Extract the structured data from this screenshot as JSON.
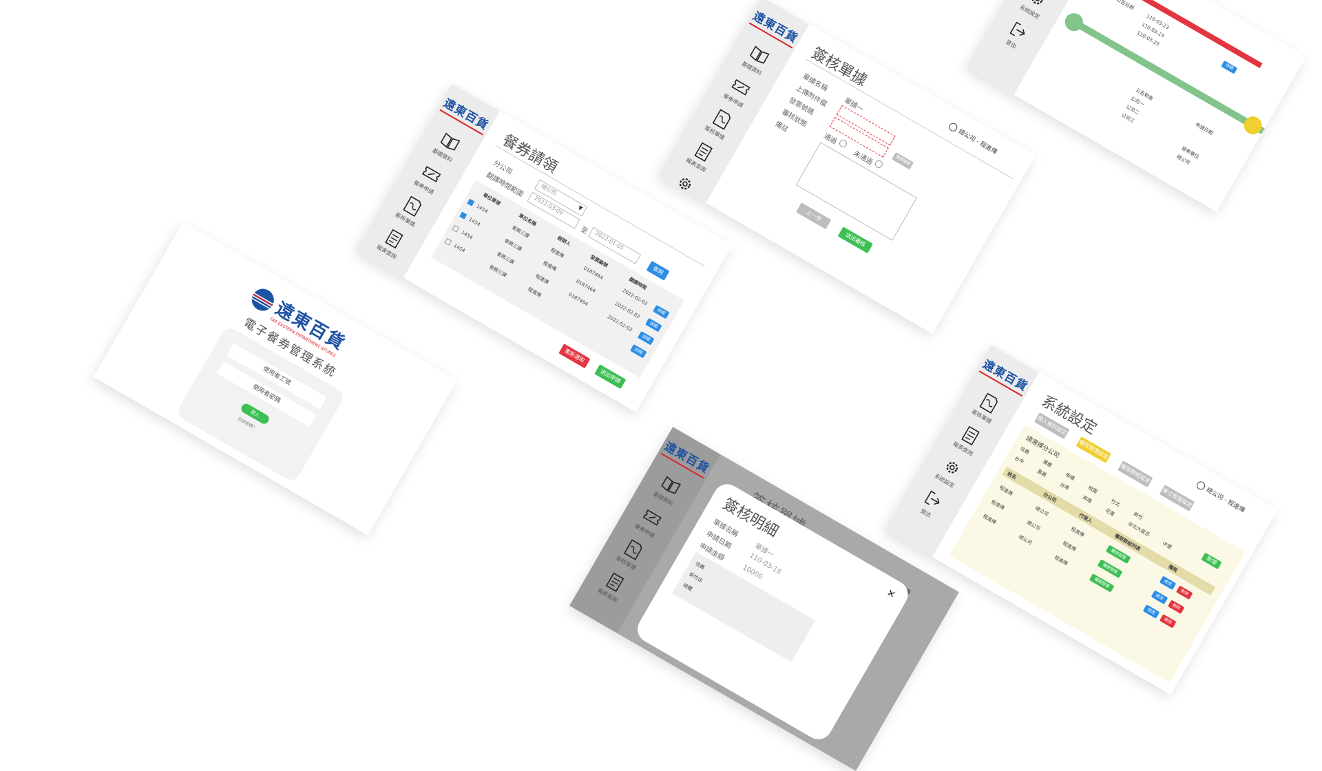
{
  "sidebar": {
    "logo": "遠東百貨",
    "items": [
      {
        "label": "基礎資料",
        "icon": "book-icon"
      },
      {
        "label": "餐券申請",
        "icon": "ticket-icon"
      },
      {
        "label": "簽核單據",
        "icon": "signed-document-icon"
      },
      {
        "label": "報表查詢",
        "icon": "report-icon"
      },
      {
        "label": "系統設定",
        "icon": "gear-icon"
      },
      {
        "label": "登出",
        "icon": "logout-icon"
      }
    ]
  },
  "user": {
    "label": "總公司 - 程進傳"
  },
  "login": {
    "brand_cn": "遠東百貨",
    "brand_en": "FAR EASTERN DEPARTMENT STORES",
    "system_title": "電子餐券管理系統",
    "username_placeholder": "使用者工號",
    "password_placeholder": "使用者密碼",
    "login_button": "登入",
    "forgot_link": "忘記密碼？"
  },
  "voucher": {
    "title": "餐券請領",
    "branch_label": "分公司",
    "branch_value": "總公司",
    "range_label": "翻譯時間範圍",
    "date_from": "2022-03-09",
    "date_to": "2022-01-05",
    "to_label": "至",
    "search_button": "查詢",
    "columns": [
      "單位單號",
      "單位名稱",
      "經辦人",
      "發票編號",
      "翻譯時間"
    ],
    "rows": [
      {
        "no": "1454",
        "name": "會務三課",
        "agent": "程進傳",
        "invoice": "0187464",
        "date": "2022-02-02"
      },
      {
        "no": "1454",
        "name": "會務三課",
        "agent": "程進傳",
        "invoice": "0187464",
        "date": "2022-02-02"
      },
      {
        "no": "1454",
        "name": "會務三課",
        "agent": "程進傳",
        "invoice": "0187464",
        "date": "2022-02-02"
      },
      {
        "no": "1454",
        "name": "會務三課",
        "agent": "程進傳",
        "invoice": "",
        "date": ""
      }
    ],
    "row_button": "詳細",
    "reset_button": "重新選取",
    "submit_button": "送出申請"
  },
  "approval": {
    "title": "簽核單據",
    "doc_name_label": "單據名稱",
    "doc_name_value": "單據一",
    "upload_label": "上傳附件檔",
    "invoice_label": "發票號碼",
    "review_label": "審核狀態",
    "note_label": "備註",
    "pass_label": "通過",
    "reject_label": "未通過",
    "file_button": "選擇檔案",
    "prev_button": "上一步",
    "submit_button": "送出審核"
  },
  "report": {
    "label": "報表查詢",
    "dates": [
      "110-03-23",
      "110-03-23",
      "110-03-23"
    ],
    "groups": [
      "公告日期",
      "公告對象",
      "申請日期",
      "發券單位"
    ],
    "targets": [
      "公司一",
      "公司二",
      "公司三"
    ],
    "branch": "總公司",
    "button": "詳細"
  },
  "settings": {
    "title": "系統設定",
    "tabs": [
      "個人資料設定",
      "權限管理設定",
      "權限群組設定",
      "單位管理設定"
    ],
    "branch_prompt": "請選擇分公司",
    "branches": [
      "信義",
      "寶慶",
      "板橋",
      "桃園",
      "竹北",
      "新竹",
      "台中",
      "嘉義",
      "台南",
      "高雄",
      "花蓮",
      "台北大直百",
      "中壢"
    ],
    "columns": [
      "姓名",
      "分公司",
      "代理人",
      "權限群組列表",
      "權限"
    ],
    "rows": [
      {
        "name": "程進傳",
        "branch": "總公司",
        "agent": "程進傳",
        "tag": "權限管理"
      },
      {
        "name": "程進傳",
        "branch": "總公司",
        "agent": "程進傳",
        "tag": "權限管理"
      },
      {
        "name": "程進傳",
        "branch": "總公司",
        "agent": "程進傳",
        "tag": "權限管理"
      }
    ],
    "add_button": "新增",
    "edit_button": "修改",
    "delete_button": "刪除"
  },
  "detail": {
    "title": "簽核明細",
    "behind_title": "簽核單據",
    "doc_name_label": "單據名稱",
    "doc_name_value": "單據一",
    "apply_date_label": "申請日期",
    "apply_date_value": "110-03-18",
    "amount_label": "申請金額",
    "amount_value": "10000",
    "rows": [
      "信義",
      "新竹店",
      "總體"
    ],
    "close_icon": "close-icon"
  },
  "colors": {
    "brand_blue": "#1d52a3",
    "brand_red": "#d8232a",
    "accent_blue": "#2d8ee6",
    "accent_green": "#3ebf55",
    "accent_red": "#e2353f",
    "accent_yellow": "#f0cf2e"
  }
}
